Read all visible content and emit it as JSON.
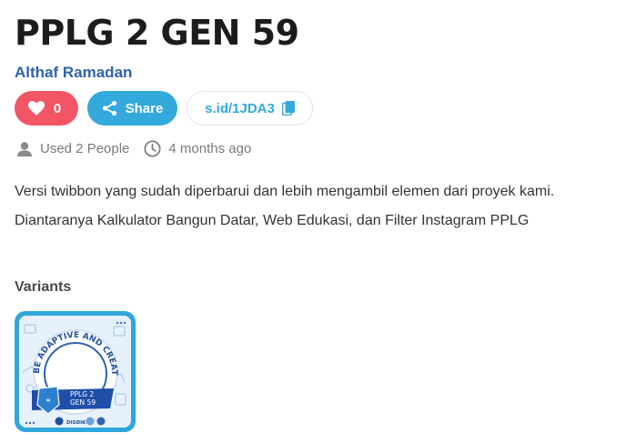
{
  "page": {
    "title": "PPLG 2 GEN 59",
    "author": "Althaf Ramadan"
  },
  "actions": {
    "like_count": "0",
    "share_label": "Share",
    "short_link": "s.id/1JDA3"
  },
  "meta": {
    "used": "Used 2 People",
    "time": "4 months ago"
  },
  "description": [
    "Versi twibbon yang sudah diperbarui dan lebih mengambil elemen dari proyek kami.",
    "Diantaranya Kalkulator Bangun Datar, Web Edukasi, dan Filter Instagram PPLG"
  ],
  "variants": {
    "title": "Variants",
    "items": [
      {
        "arc_text": "BE ADAPTIVE AND CREATIVE",
        "badge_line1": "PPLG 2",
        "badge_line2": "GEN 59",
        "logo_text": "DISDIK"
      }
    ]
  },
  "colors": {
    "like": "#f25564",
    "share": "#34a9dc",
    "author": "#2f62ae",
    "thumb_border": "#2fa6dd"
  },
  "icons": {
    "like": "heart-icon",
    "share": "share-icon",
    "copy": "copy-icon",
    "user": "user-icon",
    "clock": "clock-icon"
  }
}
